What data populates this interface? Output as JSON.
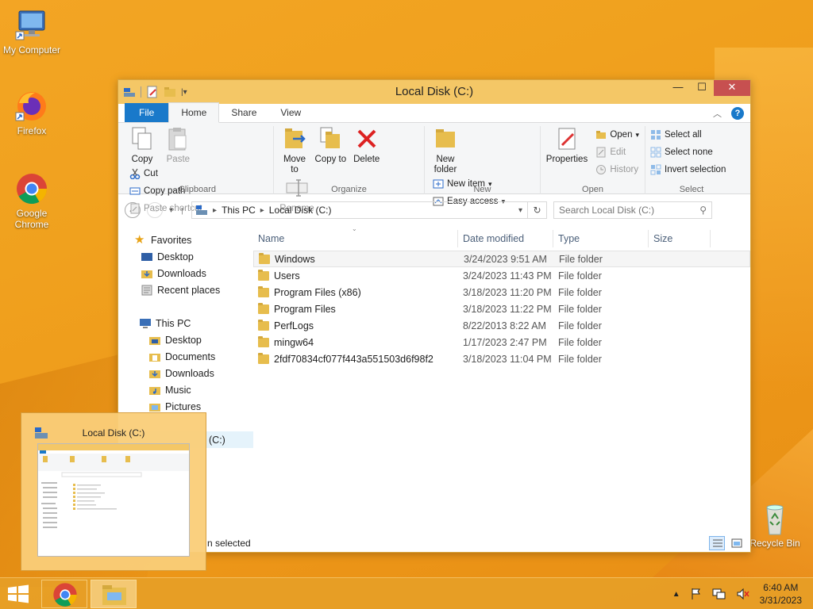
{
  "desktop": {
    "icons": [
      {
        "label": "My Computer"
      },
      {
        "label": "Firefox"
      },
      {
        "label": "Google Chrome"
      },
      {
        "label": "Recycle Bin"
      }
    ]
  },
  "window": {
    "title": "Local Disk (C:)",
    "controls": {
      "minimize": "—",
      "maximize": "☐",
      "close": "✕"
    },
    "tabs": {
      "file": "File",
      "home": "Home",
      "share": "Share",
      "view": "View"
    },
    "ribbon": {
      "clipboard": {
        "name": "Clipboard",
        "copy": "Copy",
        "paste": "Paste",
        "cut": "Cut",
        "copy_path": "Copy path",
        "paste_shortcut": "Paste shortcut"
      },
      "organize": {
        "name": "Organize",
        "move_to": "Move to",
        "copy_to": "Copy to",
        "delete": "Delete",
        "rename": "Rename"
      },
      "new": {
        "name": "New",
        "new_folder": "New folder",
        "new_item": "New item",
        "easy_access": "Easy access"
      },
      "open": {
        "name": "Open",
        "properties": "Properties",
        "open": "Open",
        "edit": "Edit",
        "history": "History"
      },
      "select": {
        "name": "Select",
        "select_all": "Select all",
        "select_none": "Select none",
        "invert": "Invert selection"
      }
    },
    "address": {
      "crumbs": [
        "This PC",
        "Local Disk (C:)"
      ],
      "search_placeholder": "Search Local Disk (C:)"
    },
    "nav": {
      "favorites": "Favorites",
      "fav_items": [
        "Desktop",
        "Downloads",
        "Recent places"
      ],
      "this_pc": "This PC",
      "pc_items": [
        "Desktop",
        "Documents",
        "Downloads",
        "Music",
        "Pictures"
      ],
      "selected_partial": "(C:)"
    },
    "columns": {
      "name": "Name",
      "date": "Date modified",
      "type": "Type",
      "size": "Size"
    },
    "files": [
      {
        "name": "Windows",
        "date": "3/24/2023 9:51 AM",
        "type": "File folder"
      },
      {
        "name": "Users",
        "date": "3/24/2023 11:43 PM",
        "type": "File folder"
      },
      {
        "name": "Program Files (x86)",
        "date": "3/18/2023 11:20 PM",
        "type": "File folder"
      },
      {
        "name": "Program Files",
        "date": "3/18/2023 11:22 PM",
        "type": "File folder"
      },
      {
        "name": "PerfLogs",
        "date": "8/22/2013 8:22 AM",
        "type": "File folder"
      },
      {
        "name": "mingw64",
        "date": "1/17/2023 2:47 PM",
        "type": "File folder"
      },
      {
        "name": "2fdf70834cf077f443a551503d6f98f2",
        "date": "3/18/2023 11:04 PM",
        "type": "File folder"
      }
    ],
    "status": "n selected"
  },
  "thumbnail": {
    "title": "Local Disk (C:)"
  },
  "taskbar": {
    "clock_time": "6:40 AM",
    "clock_date": "3/31/2023"
  },
  "colors": {
    "accent": "#1979ca",
    "titlebar": "#f4c766",
    "wallpaper": "#f0a11e"
  }
}
